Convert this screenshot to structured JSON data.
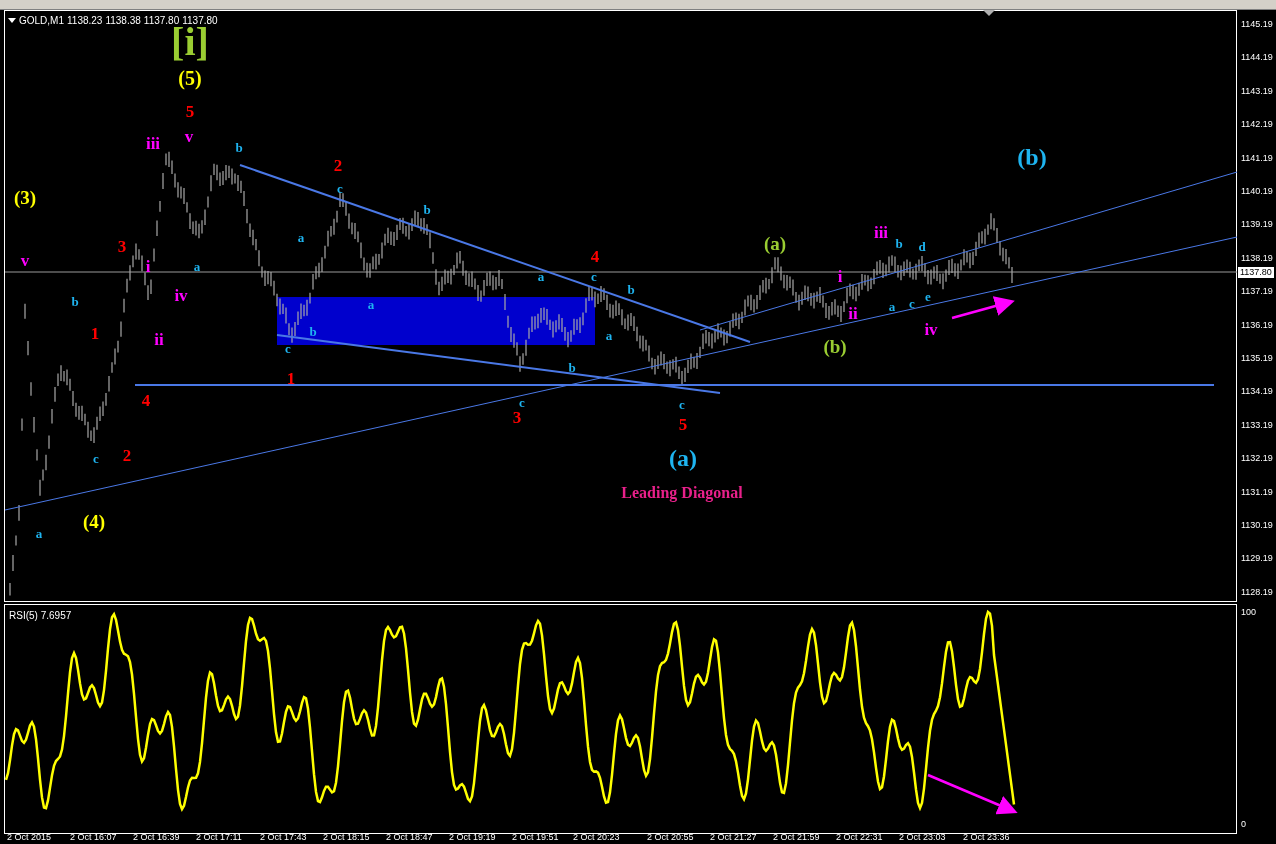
{
  "chart": {
    "symbol": "GOLD,M1",
    "ohlc": [
      "1138.23",
      "1138.38",
      "1137.80",
      "1137.80"
    ],
    "wave_labels": [
      {
        "text": "[i]",
        "color": "#9acd32"
      },
      {
        "text": "(5)",
        "color": "#ffff00"
      },
      {
        "text": "5",
        "color": "#ff0000"
      },
      {
        "text": "iii",
        "color": "#ff00ff"
      },
      {
        "text": "v",
        "color": "#ff00ff"
      },
      {
        "text": "b",
        "color": "#1eb4f0"
      },
      {
        "text": "(3)",
        "color": "#ffff00"
      },
      {
        "text": "2",
        "color": "#ff0000"
      },
      {
        "text": "c",
        "color": "#1eb4f0"
      },
      {
        "text": "b",
        "color": "#1eb4f0"
      },
      {
        "text": "3",
        "color": "#ff0000"
      },
      {
        "text": "v",
        "color": "#ff00ff"
      },
      {
        "text": "i",
        "color": "#ff00ff"
      },
      {
        "text": "a",
        "color": "#1eb4f0"
      },
      {
        "text": "iv",
        "color": "#ff00ff"
      },
      {
        "text": "a",
        "color": "#1eb4f0"
      },
      {
        "text": "b",
        "color": "#1eb4f0"
      },
      {
        "text": "1",
        "color": "#ff0000"
      },
      {
        "text": "ii",
        "color": "#ff00ff"
      },
      {
        "text": "a",
        "color": "#1eb4f0"
      },
      {
        "text": "c",
        "color": "#1eb4f0"
      },
      {
        "text": "b",
        "color": "#1eb4f0"
      },
      {
        "text": "1",
        "color": "#ff0000"
      },
      {
        "text": "4",
        "color": "#ff0000"
      },
      {
        "text": "c",
        "color": "#1eb4f0"
      },
      {
        "text": "2",
        "color": "#ff0000"
      },
      {
        "text": "a",
        "color": "#1eb4f0"
      },
      {
        "text": "4",
        "color": "#ff0000"
      },
      {
        "text": "c",
        "color": "#1eb4f0"
      },
      {
        "text": "b",
        "color": "#1eb4f0"
      },
      {
        "text": "a",
        "color": "#1eb4f0"
      },
      {
        "text": "b",
        "color": "#1eb4f0"
      },
      {
        "text": "c",
        "color": "#1eb4f0"
      },
      {
        "text": "3",
        "color": "#ff0000"
      },
      {
        "text": "c",
        "color": "#1eb4f0"
      },
      {
        "text": "5",
        "color": "#ff0000"
      },
      {
        "text": "(a)",
        "color": "#1eb4f0"
      },
      {
        "text": "(a)",
        "color": "#9acd32"
      },
      {
        "text": "(b)",
        "color": "#9acd32"
      },
      {
        "text": "i",
        "color": "#ff00ff"
      },
      {
        "text": "ii",
        "color": "#ff00ff"
      },
      {
        "text": "iii",
        "color": "#ff00ff"
      },
      {
        "text": "b",
        "color": "#1eb4f0"
      },
      {
        "text": "d",
        "color": "#1eb4f0"
      },
      {
        "text": "a",
        "color": "#1eb4f0"
      },
      {
        "text": "c",
        "color": "#1eb4f0"
      },
      {
        "text": "e",
        "color": "#1eb4f0"
      },
      {
        "text": "iv",
        "color": "#ff00ff"
      },
      {
        "text": "(b)",
        "color": "#1eb4f0"
      },
      {
        "text": "(4)",
        "color": "#ffff00"
      },
      {
        "text": "a",
        "color": "#1eb4f0"
      }
    ],
    "pattern_label": "Leading Diagonal"
  },
  "price_axis": {
    "ticks": [
      "1145.19",
      "1144.19",
      "1143.19",
      "1142.19",
      "1141.19",
      "1140.19",
      "1139.19",
      "1138.19",
      "1137.19",
      "1136.19",
      "1135.19",
      "1134.19",
      "1133.19",
      "1132.19",
      "1131.19",
      "1130.19",
      "1129.19",
      "1128.19"
    ],
    "current_price": "1137.80"
  },
  "indicator": {
    "title": "RSI(5) 7.6957",
    "scale_max": "100",
    "scale_min": "0"
  },
  "time_axis": [
    "2 Oct 2015",
    "2 Oct 16:07",
    "2 Oct 16:39",
    "2 Oct 17:11",
    "2 Oct 17:43",
    "2 Oct 18:15",
    "2 Oct 18:47",
    "2 Oct 19:19",
    "2 Oct 19:51",
    "2 Oct 20:23",
    "2 Oct 20:55",
    "2 Oct 21:27",
    "2 Oct 21:59",
    "2 Oct 22:31",
    "2 Oct 23:03",
    "2 Oct 23:36"
  ]
}
